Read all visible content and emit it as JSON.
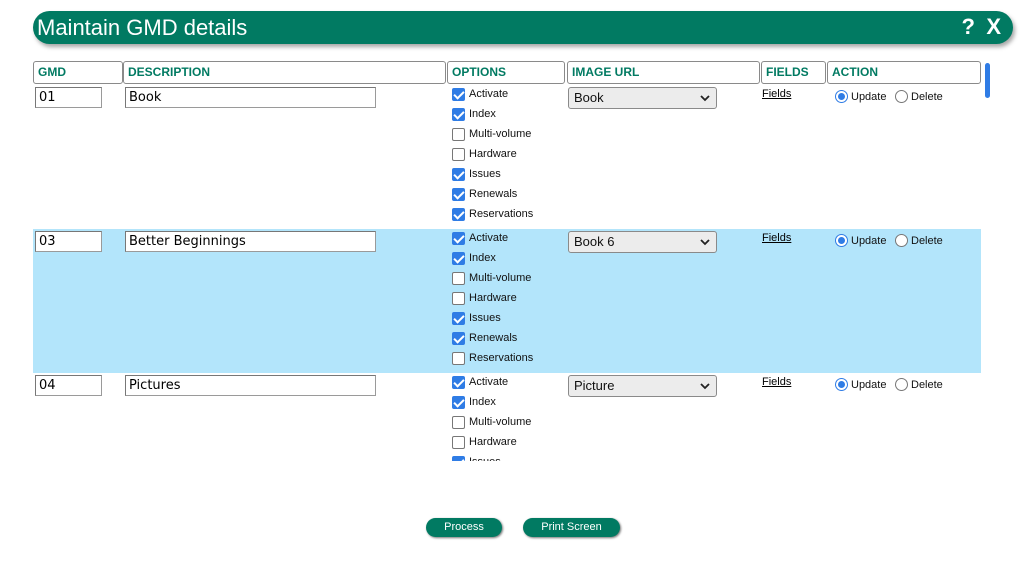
{
  "window": {
    "title": "Maintain GMD details",
    "help_label": "?",
    "close_label": "X"
  },
  "columns": {
    "gmd": "GMD",
    "description": "DESCRIPTION",
    "options": "OPTIONS",
    "image_url": "IMAGE URL",
    "fields": "FIELDS",
    "action": "ACTION"
  },
  "rows": [
    {
      "code": "01",
      "description": "Book",
      "image_url": "Book",
      "fields_link": "Fields",
      "options": [
        {
          "label": "Activate",
          "checked": true
        },
        {
          "label": "Index",
          "checked": true
        },
        {
          "label": "Multi-volume",
          "checked": false
        },
        {
          "label": "Hardware",
          "checked": false
        },
        {
          "label": "Issues",
          "checked": true
        },
        {
          "label": "Renewals",
          "checked": true
        },
        {
          "label": "Reservations",
          "checked": true
        }
      ],
      "action": {
        "update_label": "Update",
        "delete_label": "Delete",
        "selected": "Update"
      }
    },
    {
      "code": "03",
      "description": "Better Beginnings",
      "image_url": "Book 6",
      "fields_link": "Fields",
      "options": [
        {
          "label": "Activate",
          "checked": true
        },
        {
          "label": "Index",
          "checked": true
        },
        {
          "label": "Multi-volume",
          "checked": false
        },
        {
          "label": "Hardware",
          "checked": false
        },
        {
          "label": "Issues",
          "checked": true
        },
        {
          "label": "Renewals",
          "checked": true
        },
        {
          "label": "Reservations",
          "checked": false
        }
      ],
      "action": {
        "update_label": "Update",
        "delete_label": "Delete",
        "selected": "Update"
      }
    },
    {
      "code": "04",
      "description": "Pictures",
      "image_url": "Picture",
      "fields_link": "Fields",
      "options": [
        {
          "label": "Activate",
          "checked": true
        },
        {
          "label": "Index",
          "checked": true
        },
        {
          "label": "Multi-volume",
          "checked": false
        },
        {
          "label": "Hardware",
          "checked": false
        },
        {
          "label": "Issues",
          "checked": true
        }
      ],
      "action": {
        "update_label": "Update",
        "delete_label": "Delete",
        "selected": "Update"
      }
    }
  ],
  "buttons": {
    "process": "Process",
    "print_screen": "Print Screen"
  },
  "colors": {
    "brand": "#017a62",
    "row_highlight": "#b3e5fb",
    "control_blue": "#2f7ce5"
  }
}
